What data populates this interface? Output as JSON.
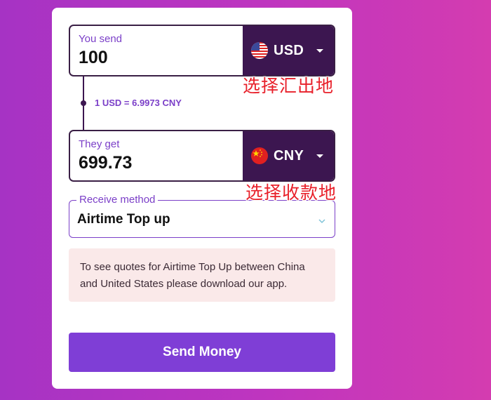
{
  "send": {
    "label": "You send",
    "amount": "100",
    "currency": "USD",
    "flag_icon": "us-flag-icon"
  },
  "rate_text": "1 USD =  6.9973 CNY",
  "receive": {
    "label": "They get",
    "amount": "699.73",
    "currency": "CNY",
    "flag_icon": "cn-flag-icon"
  },
  "annotations": {
    "send_currency": "选择汇出地",
    "receive_currency": "选择收款地"
  },
  "receive_method": {
    "label": "Receive method",
    "value": "Airtime Top up"
  },
  "notice": "To see quotes for Airtime Top Up between China and United States please download our app.",
  "send_button": "Send Money",
  "colors": {
    "accent": "#7f3ed6",
    "dark": "#3c1650",
    "annotation": "#e8202a",
    "notice_bg": "#fae9e9"
  }
}
